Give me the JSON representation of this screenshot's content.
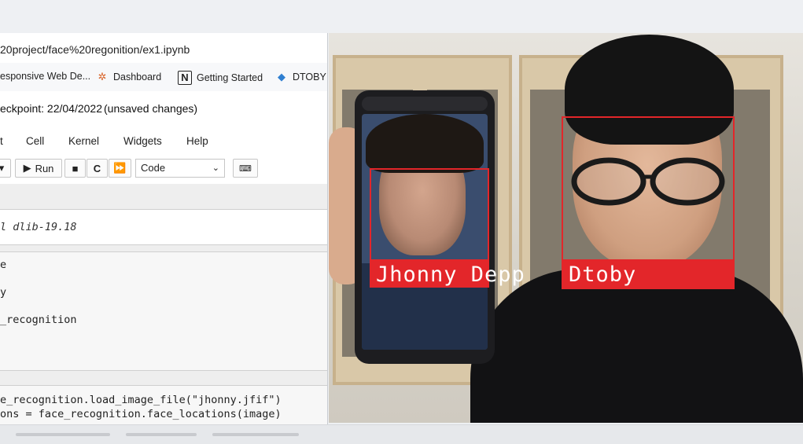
{
  "browser": {
    "address": "20project/face%20regonition/ex1.ipynb",
    "bookmarks": [
      {
        "label": "esponsive Web De...",
        "icon": "globe-icon"
      },
      {
        "label": "Dashboard",
        "icon": "dashboard-icon"
      },
      {
        "label": "Getting Started",
        "icon": "notion-icon"
      },
      {
        "label": "DTOBY",
        "icon": "diamond-icon"
      }
    ]
  },
  "notebook": {
    "checkpoint": "eckpoint: 22/04/2022",
    "unsaved": "(unsaved changes)",
    "menu": [
      "t",
      "Cell",
      "Kernel",
      "Widgets",
      "Help"
    ],
    "toolbar": {
      "run_label": "Run",
      "run_icon": "play-icon",
      "stop_icon": "stop-icon",
      "restart_icon": "restart-icon",
      "fastforward_icon": "fast-forward-icon",
      "cell_type": "Code",
      "keyboard_icon": "keyboard-icon"
    },
    "cells": {
      "output": "l dlib-19.18",
      "import_lines": [
        "e",
        "y",
        "_recognition"
      ],
      "code_lines": [
        "e_recognition.load_image_file(\"jhonny.jfif\")",
        "ons = face_recognition.face_locations(image)"
      ]
    }
  },
  "video": {
    "faces": [
      {
        "name": "Jhonny Depp"
      },
      {
        "name": "Dtoby"
      }
    ],
    "box_color": "#e3262a"
  }
}
